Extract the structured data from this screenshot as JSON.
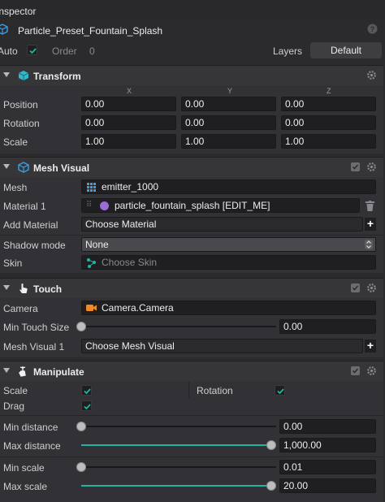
{
  "panel": {
    "title": "Inspector"
  },
  "object": {
    "name": "Particle_Preset_Fountain_Splash"
  },
  "header_row": {
    "auto_label": "Auto",
    "order_label": "Order",
    "order_value": "0",
    "layers_label": "Layers",
    "default_label": "Default"
  },
  "transform": {
    "title": "Transform",
    "axes": [
      "X",
      "Y",
      "Z"
    ],
    "position_label": "Position",
    "rotation_label": "Rotation",
    "scale_label": "Scale",
    "position": [
      "0.00",
      "0.00",
      "0.00"
    ],
    "rotation": [
      "0.00",
      "0.00",
      "0.00"
    ],
    "scale": [
      "1.00",
      "1.00",
      "1.00"
    ]
  },
  "mesh_visual": {
    "title": "Mesh Visual",
    "mesh_label": "Mesh",
    "mesh_value": "emitter_1000",
    "material1_label": "Material 1",
    "material1_value": "particle_fountain_splash [EDIT_ME]",
    "add_material_label": "Add Material",
    "add_material_value": "Choose Material",
    "shadow_mode_label": "Shadow mode",
    "shadow_mode_value": "None",
    "skin_label": "Skin",
    "skin_placeholder": "Choose Skin"
  },
  "touch": {
    "title": "Touch",
    "camera_label": "Camera",
    "camera_value": "Camera.Camera",
    "min_touch_label": "Min Touch Size",
    "min_touch_value": "0.00",
    "min_touch_fraction": 0.0,
    "mesh_visual1_label": "Mesh Visual 1",
    "mesh_visual1_value": "Choose Mesh Visual"
  },
  "manipulate": {
    "title": "Manipulate",
    "scale_label": "Scale",
    "scale_checked": true,
    "rotation_label": "Rotation",
    "rotation_checked": true,
    "drag_label": "Drag",
    "drag_checked": true,
    "min_distance_label": "Min distance",
    "min_distance_value": "0.00",
    "min_distance_fraction": 0.0,
    "max_distance_label": "Max distance",
    "max_distance_value": "1,000.00",
    "max_distance_fraction": 1.0,
    "min_scale_label": "Min scale",
    "min_scale_value": "0.01",
    "min_scale_fraction": 0.0,
    "max_scale_label": "Max scale",
    "max_scale_value": "20.00",
    "max_scale_fraction": 1.0
  },
  "colors": {
    "accent_teal": "#1fb5a2",
    "camera_orange": "#f08a24",
    "material_purple": "#9b6bd6",
    "mesh_blue": "#3aa0e8"
  }
}
